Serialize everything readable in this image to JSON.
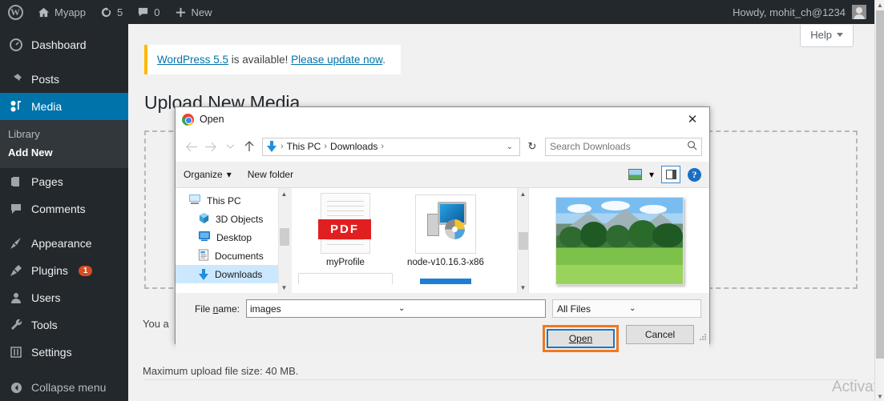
{
  "adminbar": {
    "logo_icon": "wordpress-logo-icon",
    "site_name": "Myapp",
    "home_icon": "home-icon",
    "updates_icon": "updates-icon",
    "updates_count": "5",
    "comments_icon": "comment-bubble-icon",
    "comments_count": "0",
    "new_icon": "plus-icon",
    "new_label": "New",
    "howdy": "Howdy, mohit_ch@1234",
    "avatar_icon": "avatar-icon"
  },
  "sidebar": {
    "items": [
      {
        "label": "Dashboard",
        "icon": "dashboard-icon"
      },
      {
        "label": "Posts",
        "icon": "pin-icon"
      },
      {
        "label": "Media",
        "icon": "media-icon",
        "active": true
      },
      {
        "label": "Pages",
        "icon": "pages-icon"
      },
      {
        "label": "Comments",
        "icon": "comments-icon"
      },
      {
        "label": "Appearance",
        "icon": "brush-icon"
      },
      {
        "label": "Plugins",
        "icon": "plug-icon",
        "badge": "1"
      },
      {
        "label": "Users",
        "icon": "user-icon"
      },
      {
        "label": "Tools",
        "icon": "wrench-icon"
      },
      {
        "label": "Settings",
        "icon": "settings-icon"
      }
    ],
    "media_submenu": [
      {
        "label": "Library"
      },
      {
        "label": "Add New",
        "current": true
      }
    ],
    "collapse_label": "Collapse menu",
    "collapse_icon": "collapse-arrow-icon",
    "active_color": "#0073aa",
    "bg_color": "#23282d"
  },
  "content": {
    "help_label": "Help",
    "help_caret_icon": "chevron-down-icon",
    "notice": {
      "link_version": "WordPress 5.5",
      "middle_text": " is available! ",
      "link_update": "Please update now",
      "end_text": ".",
      "accent_color": "#ffb900"
    },
    "page_title": "Upload New Media",
    "under_text_1": "You a",
    "under_text_2": "Maximum upload file size: 40 MB.",
    "watermark": "Activat"
  },
  "dialog": {
    "title": "Open",
    "app_icon": "chrome-icon",
    "close_icon": "close-icon",
    "nav": {
      "back_icon": "arrow-left-icon",
      "forward_icon": "arrow-right-icon",
      "recent_icon": "chevron-down-icon",
      "up_icon": "arrow-up-icon",
      "location_icon": "downloads-icon",
      "crumbs": [
        "This PC",
        "Downloads"
      ],
      "crumb_caret_icon": "chevron-down-icon",
      "refresh_icon": "refresh-icon",
      "search_placeholder": "Search Downloads",
      "search_icon": "search-icon"
    },
    "toolbar": {
      "organize_label": "Organize",
      "organize_caret_icon": "caret-down-icon",
      "new_folder_label": "New folder",
      "view_icon": "view-options-icon",
      "view_caret_icon": "caret-down-icon",
      "preview_pane_icon": "preview-pane-icon",
      "help_icon": "help-icon"
    },
    "tree": [
      {
        "label": "This PC",
        "icon": "computer-icon",
        "indent": false
      },
      {
        "label": "3D Objects",
        "icon": "3d-objects-icon",
        "indent": true
      },
      {
        "label": "Desktop",
        "icon": "desktop-icon",
        "indent": true
      },
      {
        "label": "Documents",
        "icon": "documents-icon",
        "indent": true
      },
      {
        "label": "Downloads",
        "icon": "downloads-icon",
        "indent": true,
        "selected": true
      }
    ],
    "files": [
      {
        "name": "myProfile",
        "icon": "pdf-file-icon",
        "badge": "PDF"
      },
      {
        "name": "node-v10.16.3-x86",
        "icon": "installer-file-icon"
      }
    ],
    "preview_icon": "image-preview-landscape",
    "filename_label": "File name:",
    "filename_value": "images",
    "filename_caret_icon": "chevron-down-icon",
    "filetype_value": "All Files",
    "filetype_caret_icon": "chevron-down-icon",
    "open_button": "Open",
    "cancel_button": "Cancel",
    "highlight_color": "#f07820",
    "focus_color": "#1878c8"
  }
}
